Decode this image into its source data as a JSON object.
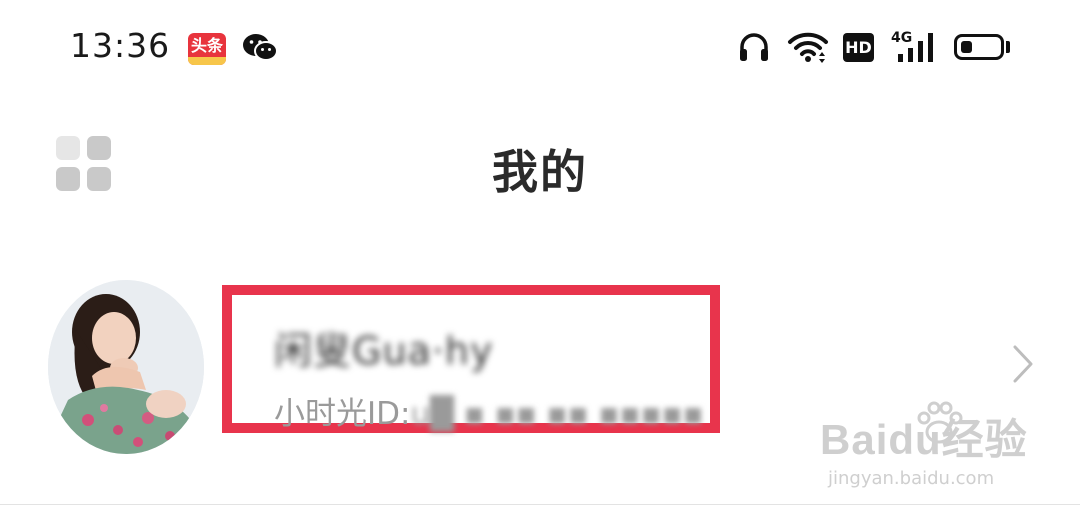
{
  "status_bar": {
    "time": "13:36",
    "app_badge_text": "头条",
    "network": "4G",
    "hd_label": "HD",
    "battery_level": 0.3,
    "icons": [
      "toutiao-app-icon",
      "wechat-icon",
      "headphones-icon",
      "wifi-icon",
      "hd-icon",
      "signal-icon",
      "battery-icon"
    ]
  },
  "header": {
    "title": "我的",
    "left_icon": "grid-icon"
  },
  "profile": {
    "nickname": "闲叟Gua·hy",
    "id_label": "小时光ID:",
    "id_value": "u█ ▪ ▪▪ ▪▪ ▪▪▪▪▪",
    "avatar": "avatar-photo",
    "chevron": "chevron-right-icon"
  },
  "annotation": {
    "highlight_color": "#e8344c"
  },
  "watermark": {
    "brand": "Baidu经验",
    "url": "jingyan.baidu.com"
  }
}
